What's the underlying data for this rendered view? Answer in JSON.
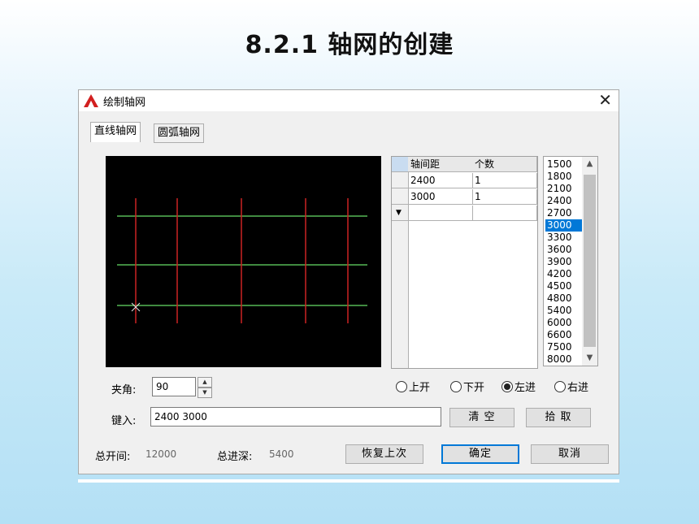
{
  "slide": {
    "title": "8.2.1  轴网的创建"
  },
  "dialog": {
    "title": "绘制轴网",
    "tabs": [
      "直线轴网",
      "圆弧轴网"
    ],
    "table": {
      "headers": [
        "轴间距",
        "个数"
      ],
      "rows": [
        {
          "spacing": "2400",
          "count": "1"
        },
        {
          "spacing": "3000",
          "count": "1"
        }
      ]
    },
    "spacing_list": {
      "items": [
        "1500",
        "1800",
        "2100",
        "2400",
        "2700",
        "3000",
        "3300",
        "3600",
        "3900",
        "4200",
        "4500",
        "4800",
        "5400",
        "6000",
        "6600",
        "7500",
        "8000"
      ],
      "selected": "3000"
    },
    "angle_label": "夹角:",
    "angle_value": "90",
    "radios": [
      {
        "label": "上开",
        "checked": false
      },
      {
        "label": "下开",
        "checked": false
      },
      {
        "label": "左进",
        "checked": true
      },
      {
        "label": "右进",
        "checked": false
      }
    ],
    "input_label": "键入:",
    "input_value": "2400  3000",
    "clear_button": "清  空",
    "pick_button": "拾  取",
    "total_bay_label": "总开间:",
    "total_bay_value": "12000",
    "total_depth_label": "总进深:",
    "total_depth_value": "5400",
    "restore_button": "恢复上次",
    "ok_button": "确定",
    "cancel_button": "取消"
  },
  "colors": {
    "grid_vertical": "#cc2222",
    "grid_horizontal": "#55b855",
    "accent": "#0078d7"
  }
}
